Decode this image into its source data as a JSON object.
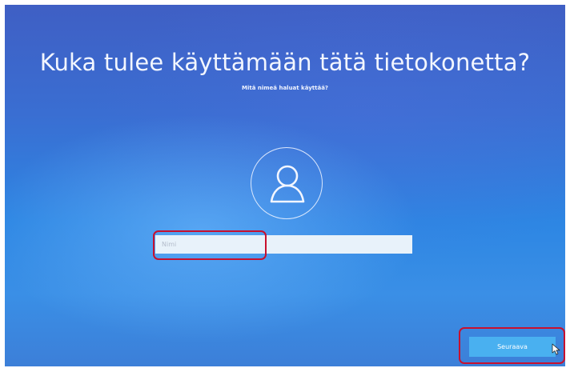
{
  "setup": {
    "title": "Kuka tulee käyttämään tätä tietokonetta?",
    "subtitle": "Mitä nimeä haluat käyttää?",
    "avatar_icon": "user-icon",
    "name_field": {
      "value": "",
      "placeholder": "Nimi"
    },
    "next_label": "Seuraava",
    "highlight_color": "#c8102e",
    "button_color": "#49b0f0"
  }
}
